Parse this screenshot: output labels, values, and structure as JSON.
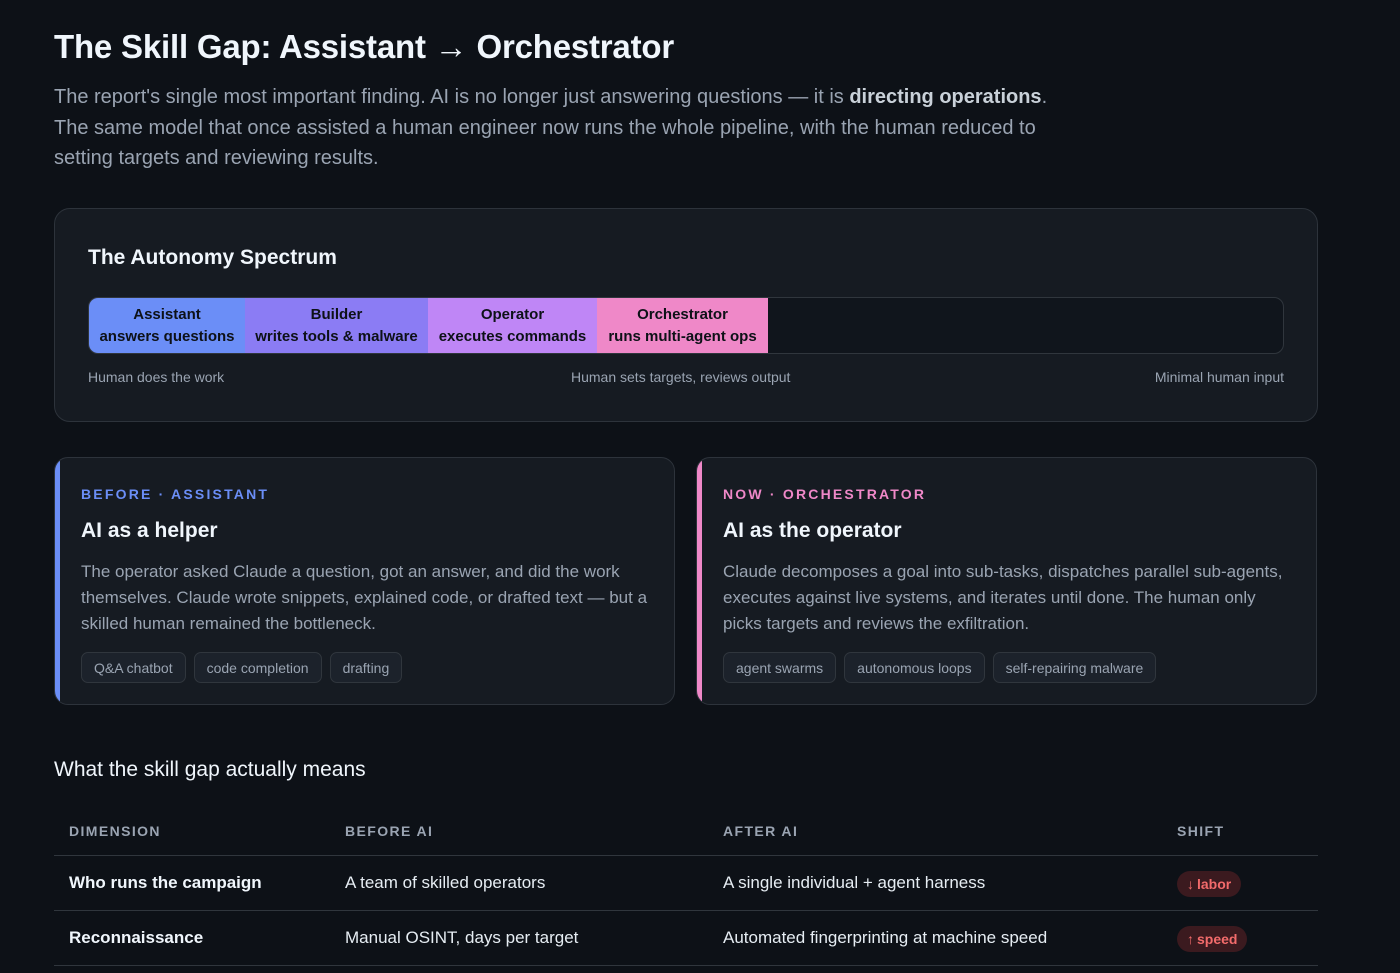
{
  "header": {
    "title": "The Skill Gap: Assistant → Orchestrator",
    "intro_part1": "The report's single most important finding. AI is no longer just answering questions — it is ",
    "intro_bold": "directing operations",
    "intro_part2": ". The same model that once assisted a human engineer now runs the whole pipeline, with the human reduced to setting targets and reviewing results."
  },
  "spectrum": {
    "title": "The Autonomy Spectrum",
    "segments": [
      {
        "name": "Assistant",
        "desc": "answers questions",
        "color": "#6b8ef7"
      },
      {
        "name": "Builder",
        "desc": "writes tools & malware",
        "color": "#8b7cf4"
      },
      {
        "name": "Operator",
        "desc": "executes commands",
        "color": "#bf86f6"
      },
      {
        "name": "Orchestrator",
        "desc": "runs multi-agent ops",
        "color": "#ef88c8"
      }
    ],
    "axis_left": "Human does the work",
    "axis_mid": "Human sets targets, reviews output",
    "axis_right": "Minimal human input"
  },
  "before_card": {
    "kicker": "BEFORE · ASSISTANT",
    "heading": "AI as a helper",
    "body": "The operator asked Claude a question, got an answer, and did the work themselves. Claude wrote snippets, explained code, or drafted text — but a skilled human remained the bottleneck.",
    "tags": [
      "Q&A chatbot",
      "code completion",
      "drafting"
    ],
    "accent": "#6b8ef7"
  },
  "now_card": {
    "kicker": "NOW · ORCHESTRATOR",
    "heading": "AI as the operator",
    "body": "Claude decomposes a goal into sub-tasks, dispatches parallel sub-agents, executes against live systems, and iterates until done. The human only picks targets and reviews the exfiltration.",
    "tags": [
      "agent swarms",
      "autonomous loops",
      "self-repairing malware"
    ],
    "accent": "#ef88c8"
  },
  "table": {
    "section_title": "What the skill gap actually means",
    "headers": [
      "DIMENSION",
      "BEFORE AI",
      "AFTER AI",
      "SHIFT"
    ],
    "rows": [
      {
        "dimension": "Who runs the campaign",
        "before": "A team of skilled operators",
        "after": "A single individual + agent harness",
        "shift_arrow": "↓",
        "shift": "labor"
      },
      {
        "dimension": "Reconnaissance",
        "before": "Manual OSINT, days per target",
        "after": "Automated fingerprinting at machine speed",
        "shift_arrow": "↑",
        "shift": "speed"
      }
    ],
    "shift_color": "#f26b6b"
  }
}
